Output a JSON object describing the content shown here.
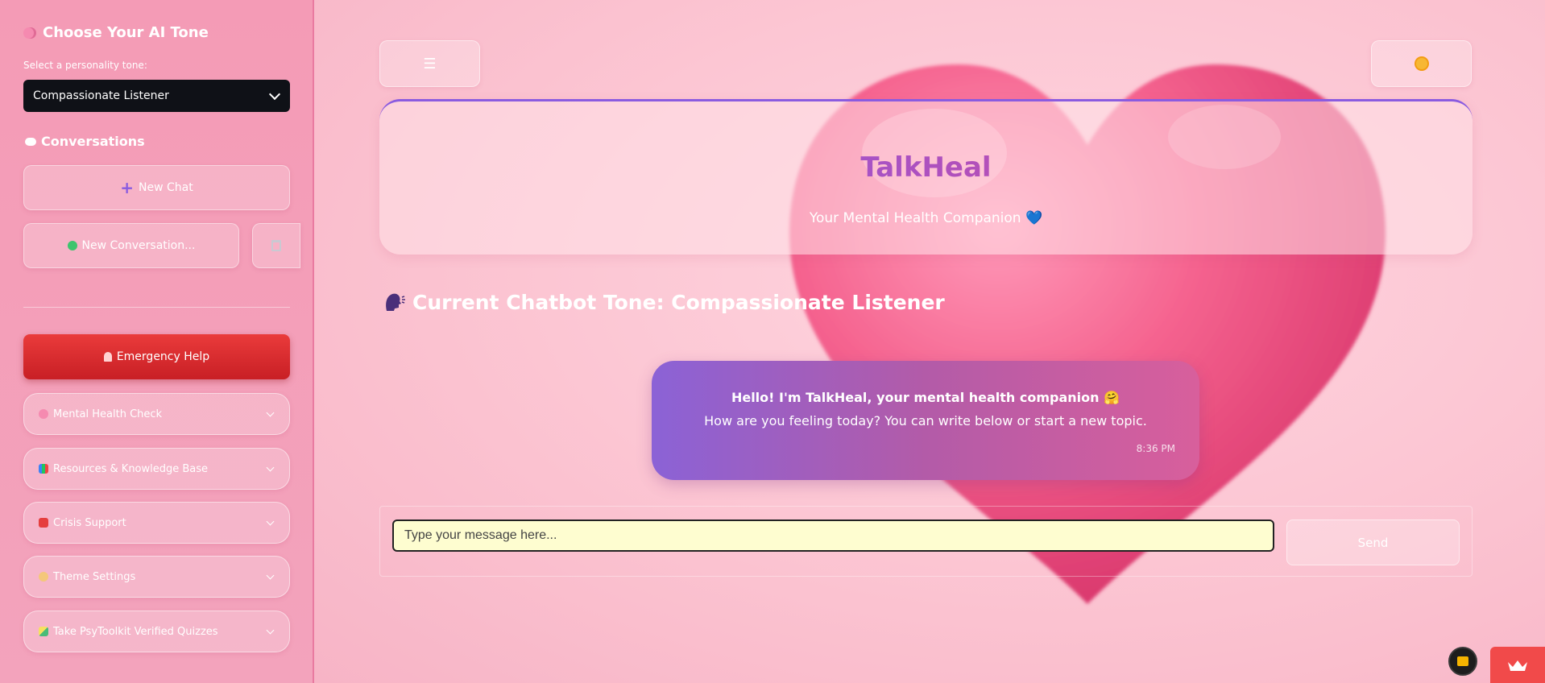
{
  "sidebar": {
    "tone_title": "Choose Your AI Tone",
    "tone_label": "Select a personality tone:",
    "tone_selected": "Compassionate Listener",
    "conversations_title": "Conversations",
    "new_chat_label": "New Chat",
    "conversation_item_label": "New Conversation...",
    "emergency_label": "Emergency Help",
    "sections": [
      {
        "label": "Mental Health Check",
        "icon": "brain-icon"
      },
      {
        "label": "Resources & Knowledge Base",
        "icon": "books-icon"
      },
      {
        "label": "Crisis Support",
        "icon": "phone-icon"
      },
      {
        "label": "Theme Settings",
        "icon": "palette-icon"
      },
      {
        "label": "Take PsyToolkit Verified Quizzes",
        "icon": "pencil-icon"
      }
    ]
  },
  "header": {
    "title": "TalkHeal",
    "subtitle": "Your Mental Health Companion 💙"
  },
  "main": {
    "tone_heading": "Current Chatbot Tone: Compassionate Listener",
    "message": {
      "line1": "Hello! I'm TalkHeal, your mental health companion 🤗",
      "line2": "How are you feeling today? You can write below or start a new topic.",
      "time": "8:36 PM"
    },
    "input_placeholder": "Type your message here...",
    "send_label": "Send"
  },
  "colors": {
    "accent_purple": "#8b62d6",
    "accent_pink": "#e0468e",
    "emergency_red": "#d62b2e",
    "input_bg": "#fefdd0"
  }
}
